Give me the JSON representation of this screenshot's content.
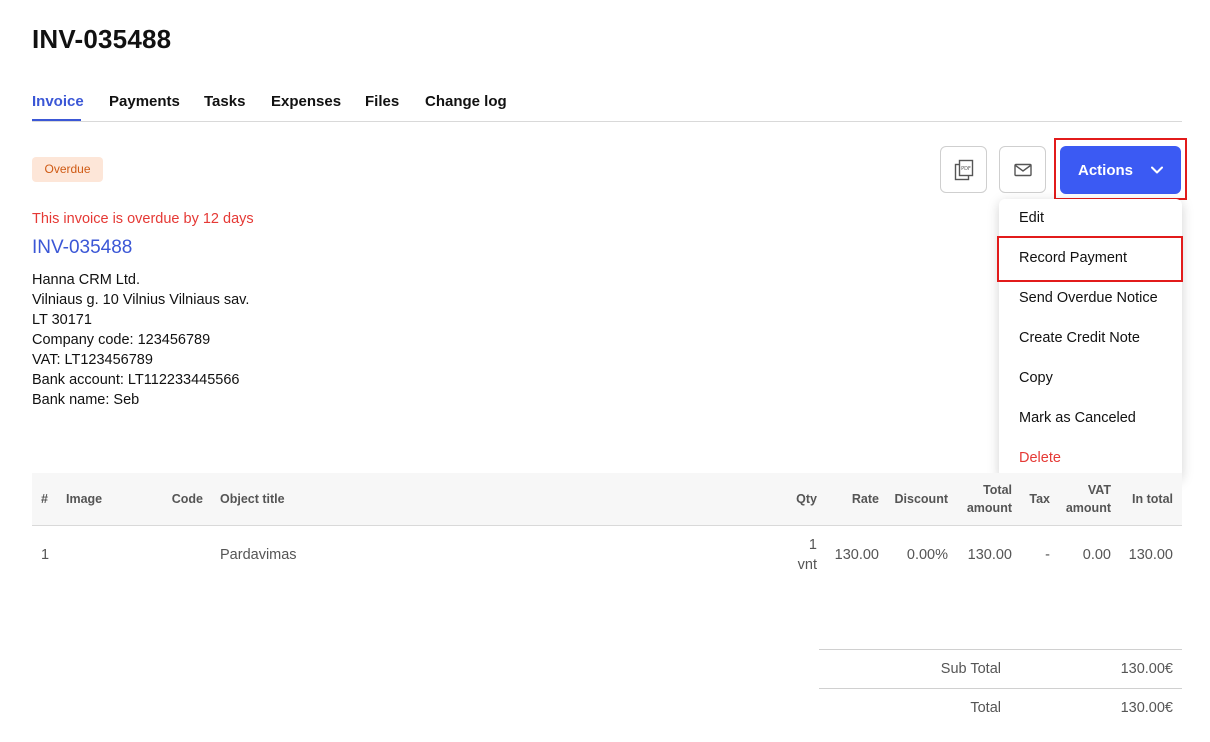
{
  "page": {
    "title": "INV-035488"
  },
  "tabs": [
    {
      "label": "Invoice",
      "active": true
    },
    {
      "label": "Payments"
    },
    {
      "label": "Tasks"
    },
    {
      "label": "Expenses"
    },
    {
      "label": "Files"
    },
    {
      "label": "Change log"
    }
  ],
  "status": {
    "badge": "Overdue",
    "badge_color": "#cf5a14",
    "overdue_message": "This invoice is overdue by 12 days"
  },
  "toolbar": {
    "pdf_icon": "pdf-icon",
    "mail_icon": "mail-icon",
    "actions_label": "Actions",
    "accent_color": "#3b5af3"
  },
  "actions_menu": {
    "items": [
      "Edit",
      "Record Payment",
      "Send Overdue Notice",
      "Create Credit Note",
      "Copy",
      "Mark as Canceled",
      "Delete"
    ]
  },
  "invoice": {
    "number": "INV-035488",
    "company_lines": [
      "Hanna CRM Ltd.",
      "Vilniaus g. 10 Vilnius Vilniaus sav.",
      "LT 30171",
      "Company code: 123456789",
      "VAT: LT123456789",
      "Bank account: LT112233445566",
      "Bank name: Seb"
    ]
  },
  "table": {
    "headers": {
      "num": "#",
      "image": "Image",
      "code": "Code",
      "title": "Object title",
      "qty": "Qty",
      "rate": "Rate",
      "discount": "Discount",
      "total_l1": "Total",
      "total_l2": "amount",
      "tax": "Tax",
      "vat_l1": "VAT",
      "vat_l2": "amount",
      "in_total": "In total"
    },
    "rows": [
      {
        "num": "1",
        "image": "",
        "code": "",
        "title": "Pardavimas",
        "qty": "1",
        "unit": "vnt",
        "rate": "130.00",
        "discount": "0.00%",
        "total_amount": "130.00",
        "tax": "-",
        "vat_amount": "0.00",
        "in_total": "130.00"
      }
    ]
  },
  "totals": {
    "subtotal_label": "Sub Total",
    "subtotal_value": "130.00€",
    "total_label": "Total",
    "total_value": "130.00€"
  }
}
